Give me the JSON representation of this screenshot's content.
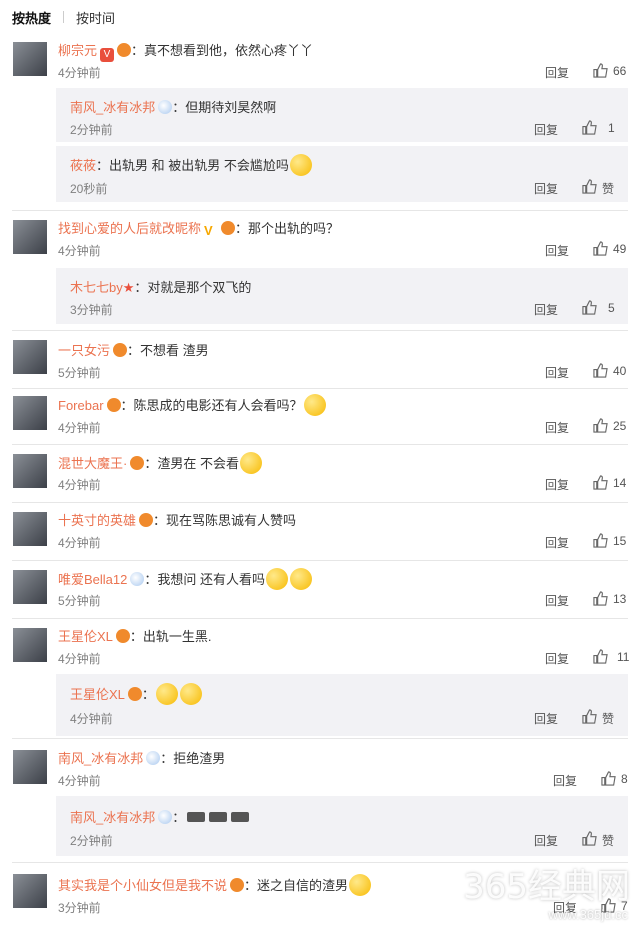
{
  "tabs": [
    "按热度",
    "按时间"
  ],
  "reply_label": "回复",
  "like_label": "赞",
  "comments": [
    {
      "name": "柳宗元",
      "text": "：真不想看到他，依然心疼丫丫",
      "time": "4分钟前",
      "likes": "66"
    },
    {
      "name": "南风_冰有冰邦",
      "text": "：但期待刘昊然啊",
      "time": "2分钟前",
      "likes": "1"
    },
    {
      "name": "莜莜",
      "text": "：出轨男 和 被出轨男 不会尴尬吗",
      "time": "20秒前",
      "likes": "赞"
    },
    {
      "name": "找到心爱的人后就改昵称",
      "text": "：那个出轨的吗？",
      "time": "4分钟前",
      "likes": "49"
    },
    {
      "name": "木七七by",
      "text": "：对就是那个双飞的",
      "time": "3分钟前",
      "likes": "5"
    },
    {
      "name": "一只女污",
      "text": "：不想看 渣男",
      "time": "5分钟前",
      "likes": "40"
    },
    {
      "name": "Forebar",
      "text": "：陈思成的电影还有人会看吗？",
      "time": "4分钟前",
      "likes": "25"
    },
    {
      "name": "混世大魔王·",
      "text": "：渣男在 不会看",
      "time": "4分钟前",
      "likes": "14"
    },
    {
      "name": "十英寸的英雄",
      "text": "：现在骂陈思诚有人赞吗",
      "time": "4分钟前",
      "likes": "15"
    },
    {
      "name": "唯爱Bella12",
      "text": "：我想问 还有人看吗",
      "time": "5分钟前",
      "likes": "13"
    },
    {
      "name": "王星伦XL",
      "text": "：出轨一生黑.",
      "time": "4分钟前",
      "likes": "11"
    },
    {
      "name": "王星伦XL",
      "text": "：",
      "time": "4分钟前",
      "likes": "赞"
    },
    {
      "name": "南风_冰有冰邦",
      "text": "：拒绝渣男",
      "time": "4分钟前",
      "likes": "8"
    },
    {
      "name": "南风_冰有冰邦",
      "text": "：",
      "time": "2分钟前",
      "likes": "赞"
    },
    {
      "name": "其实我是个小仙女但是我不说",
      "text": "：迷之自信的渣男",
      "time": "3分钟前",
      "likes": "7"
    }
  ],
  "watermark": {
    "main": "365经典网",
    "sub": "www.365jd.cc"
  }
}
